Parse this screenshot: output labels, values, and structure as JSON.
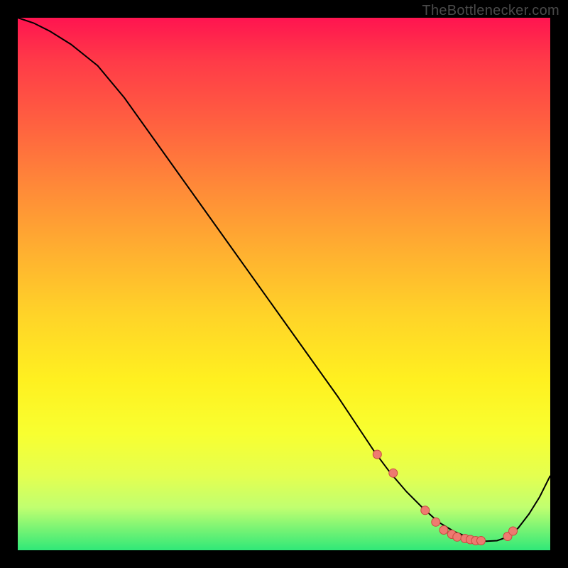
{
  "watermark": "TheBottlenecker.com",
  "chart_data": {
    "type": "line",
    "title": "",
    "xlabel": "",
    "ylabel": "",
    "xlim": [
      0,
      100
    ],
    "ylim": [
      0,
      100
    ],
    "series": [
      {
        "name": "curve",
        "x": [
          0,
          3,
          6,
          10,
          15,
          20,
          25,
          30,
          35,
          40,
          45,
          50,
          55,
          60,
          64,
          67,
          70,
          73,
          76,
          79,
          82,
          85,
          88,
          90,
          92,
          94,
          96,
          98,
          100
        ],
        "y": [
          100,
          99,
          97.5,
          95,
          91,
          85,
          78,
          71,
          64,
          57,
          50,
          43,
          36,
          29,
          23,
          18.5,
          14.5,
          11,
          8,
          5.3,
          3.5,
          2.3,
          1.7,
          1.8,
          2.5,
          4.2,
          6.8,
          10,
          14
        ],
        "color": "#000000"
      }
    ],
    "markers": {
      "name": "dots",
      "x": [
        67.5,
        70.5,
        76.5,
        78.5,
        80,
        81.5,
        82.5,
        84,
        85,
        86,
        87,
        92,
        93
      ],
      "y": [
        18,
        14.5,
        7.5,
        5.3,
        3.8,
        3.0,
        2.5,
        2.2,
        2.0,
        1.8,
        1.8,
        2.6,
        3.6
      ],
      "color": "#ee7a70"
    }
  }
}
